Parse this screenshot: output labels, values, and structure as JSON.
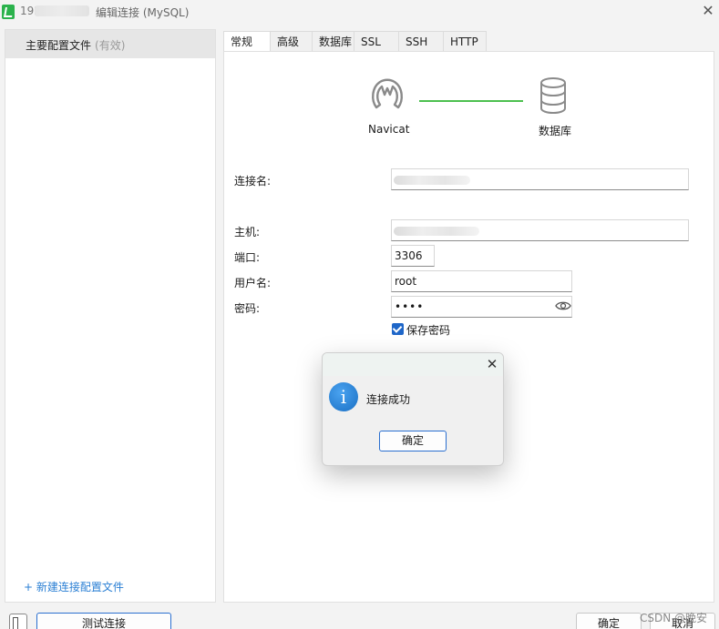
{
  "window": {
    "title_prefix": "192",
    "title": "编辑连接 (MySQL)"
  },
  "sidebar": {
    "profile_label": "主要配置文件",
    "profile_status": "(有效)",
    "new_profile": "+ 新建连接配置文件"
  },
  "tabs": [
    "常规",
    "高级",
    "数据库",
    "SSL",
    "SSH",
    "HTTP"
  ],
  "graphic": {
    "left_label": "Navicat",
    "right_label": "数据库",
    "line_color": "#4cc04f"
  },
  "form": {
    "conn_name_label": "连接名:",
    "host_label": "主机:",
    "port_label": "端口:",
    "port_value": "3306",
    "user_label": "用户名:",
    "user_value": "root",
    "password_label": "密码:",
    "password_value": "••••",
    "save_password_label": "保存密码"
  },
  "dialog": {
    "message": "连接成功",
    "ok_label": "确定",
    "icon": "info-icon"
  },
  "footer": {
    "test_label": "测试连接",
    "ok_label": "确定",
    "cancel_label": "取消",
    "watermark": "CSDN @晚安"
  },
  "colors": {
    "accent": "#1e66c8",
    "link": "#2a7fd4"
  }
}
